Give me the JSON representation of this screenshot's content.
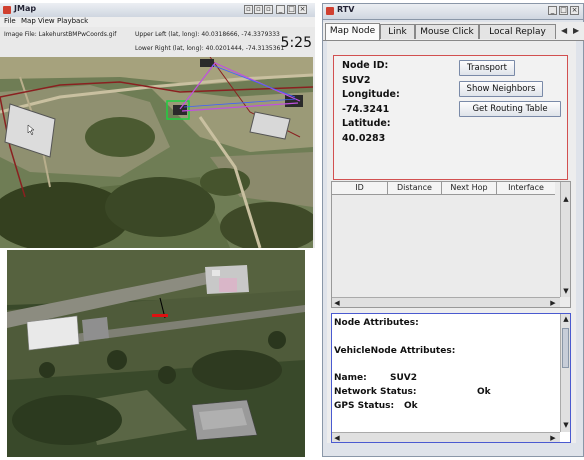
{
  "jmap": {
    "title": "JMap",
    "menu": [
      "File",
      "Map",
      "View",
      "Playback"
    ],
    "image_file": "Image File: LakehurstBMPwCoords.gif",
    "upper_left": "Upper Left (lat, long): 40.0318666, -74.3379333",
    "lower_right": "Lower Right (lat, long): 40.0201444, -74.3135361",
    "clock": "5:25"
  },
  "rtv": {
    "title": "RTV",
    "tabs": [
      "Map Node",
      "Link",
      "Mouse Click",
      "Local Replay"
    ],
    "node_id_label": "Node ID:",
    "node_id": "SUV2",
    "longitude_label": "Longitude:",
    "longitude": "-74.3241",
    "latitude_label": "Latitude:",
    "latitude": "40.0283",
    "buttons": {
      "transport": "Transport",
      "show_neighbors": "Show Neighbors",
      "routing_table": "Get Routing Table"
    },
    "table_headers": [
      "ID",
      "Distance",
      "Next Hop",
      "Interface"
    ],
    "attributes": {
      "node_attributes": "Node Attributes:",
      "vehicle_attributes": "VehicleNode Attributes:",
      "name_label": "Name:",
      "name_value": "SUV2",
      "network_label": "Network Status:",
      "network_value": "Ok",
      "gps_label": "GPS Status:",
      "gps_value": "Ok"
    }
  },
  "colors": {
    "selection_box": "#d25050",
    "attr_border": "#4a5ad0",
    "link_lines": "#c050e0"
  }
}
